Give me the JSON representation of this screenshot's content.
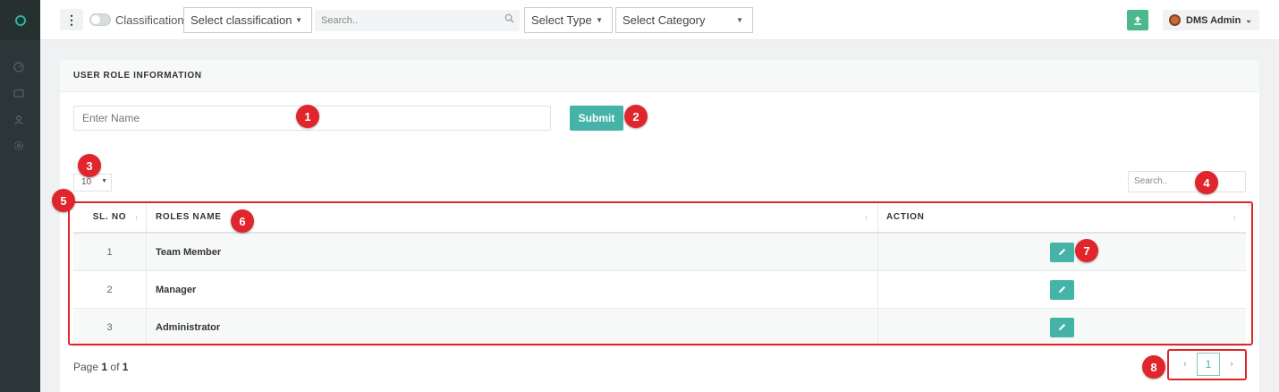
{
  "topbar": {
    "toggle_label": "Classification",
    "classification_select": "Select classification",
    "search_placeholder": "Search..",
    "type_select": "Select Type",
    "category_select": "Select Category",
    "user_name": "DMS Admin"
  },
  "card": {
    "title": "USER ROLE INFORMATION",
    "name_placeholder": "Enter Name",
    "submit_label": "Submit",
    "page_length": "10",
    "table_search_placeholder": "Search.."
  },
  "table": {
    "columns": [
      "SL. NO",
      "ROLES NAME",
      "ACTION"
    ],
    "rows": [
      {
        "sl": "1",
        "name": "Team Member"
      },
      {
        "sl": "2",
        "name": "Manager"
      },
      {
        "sl": "3",
        "name": "Administrator"
      }
    ]
  },
  "pagination": {
    "page_text": "Page",
    "current": "1",
    "of_text": "of",
    "total": "1"
  },
  "annotations": [
    "1",
    "2",
    "3",
    "4",
    "5",
    "6",
    "7",
    "8"
  ],
  "colors": {
    "accent": "#45b3a7",
    "annotation": "#e0252c",
    "sidebar": "#2b3638"
  }
}
